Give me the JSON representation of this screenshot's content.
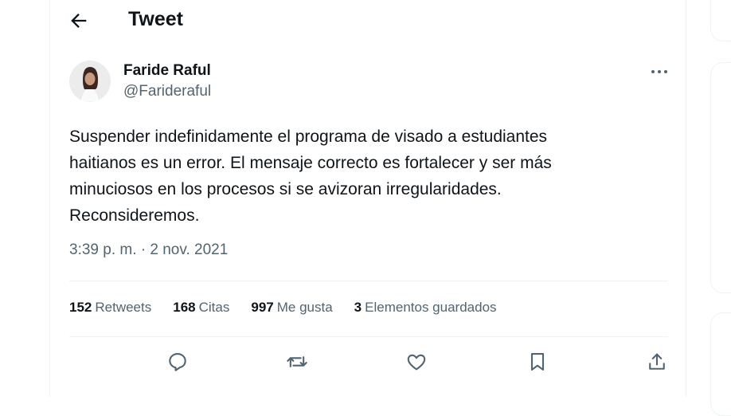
{
  "header": {
    "title": "Tweet",
    "back_icon": "arrow-left-icon"
  },
  "tweet": {
    "author_name": "Faride Raful",
    "author_handle": "@Farideraful",
    "text": "Suspender indefinidamente el programa de visado a estudiantes\nhaitianos es un error. El mensaje correcto es fortalecer y ser más\nminuciosos en los procesos si se avizoran irregularidades.\nReconsideremos.",
    "timestamp": "3:39 p. m. · 2 nov. 2021"
  },
  "stats": [
    {
      "count": "152",
      "label": "Retweets"
    },
    {
      "count": "168",
      "label": "Citas"
    },
    {
      "count": "997",
      "label": "Me gusta"
    },
    {
      "count": "3",
      "label": "Elementos guardados"
    }
  ],
  "actions": [
    "reply-icon",
    "retweet-icon",
    "like-icon",
    "bookmark-icon",
    "share-icon"
  ]
}
